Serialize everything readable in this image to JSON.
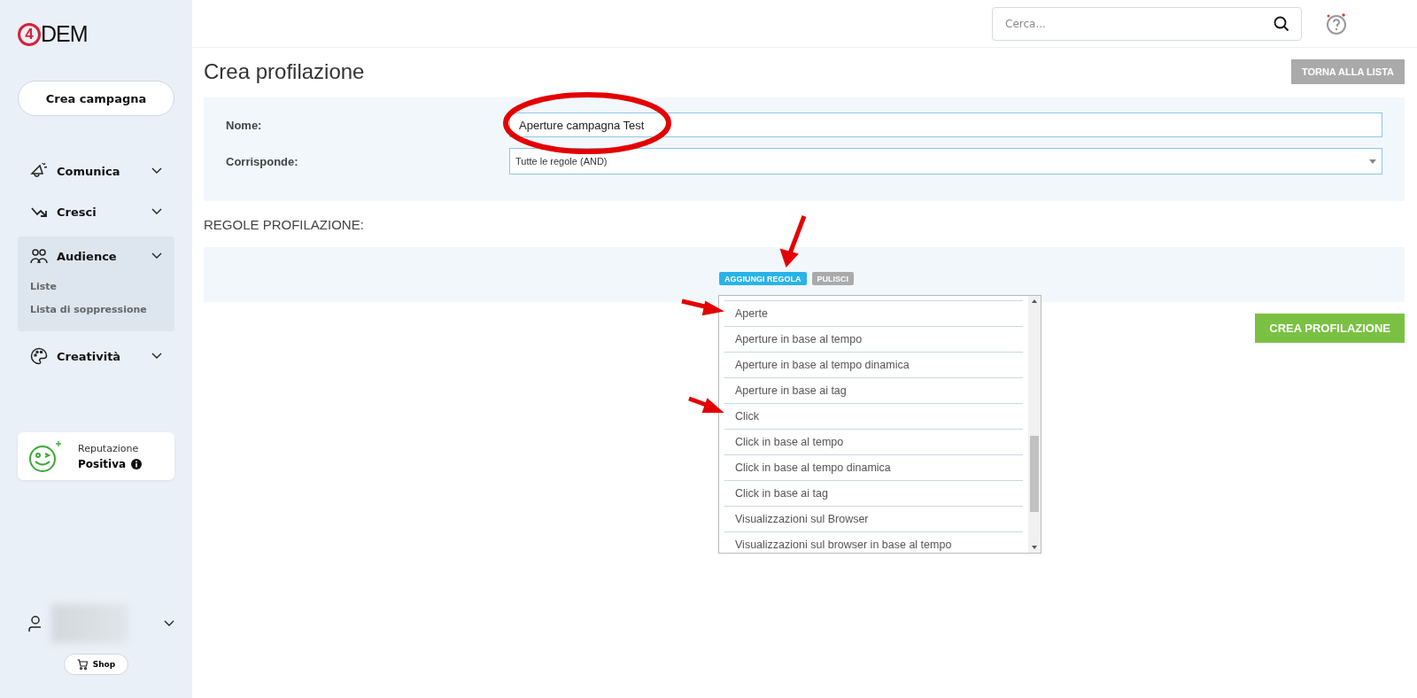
{
  "sidebar": {
    "logo": {
      "mark": "4",
      "text": "DEM"
    },
    "create_button": "Crea campagna",
    "nav": [
      {
        "label": "Comunica",
        "expanded": false
      },
      {
        "label": "Cresci",
        "expanded": false
      },
      {
        "label": "Audience",
        "expanded": true,
        "children": [
          {
            "label": "Liste"
          },
          {
            "label": "Lista di soppressione"
          }
        ]
      },
      {
        "label": "Creatività",
        "expanded": false
      }
    ],
    "reputation": {
      "label": "Reputazione",
      "value": "Positiva"
    },
    "shop_button": "Shop"
  },
  "topbar": {
    "search": {
      "placeholder": "Cerca..."
    }
  },
  "page": {
    "title": "Crea profilazione",
    "back_button": "TORNA ALLA LISTA",
    "form": [
      {
        "label": "Nome:",
        "kind": "input",
        "value": "Aperture campagna Test"
      },
      {
        "label": "Corrisponde:",
        "kind": "select",
        "value": "Tutte le regole (AND)"
      }
    ],
    "rules_heading": "REGOLE PROFILAZIONE:",
    "rule_buttons": [
      {
        "label": "AGGIUNGI REGOLA",
        "kind": "primary"
      },
      {
        "label": "PULISCI",
        "kind": "secondary"
      }
    ],
    "rule_options": [
      {
        "label": "Aperte"
      },
      {
        "label": "Aperture in base al tempo"
      },
      {
        "label": "Aperture in base al tempo dinamica"
      },
      {
        "label": "Aperture in base ai tag"
      },
      {
        "label": "Click"
      },
      {
        "label": "Click in base al tempo"
      },
      {
        "label": "Click in base al tempo dinamica"
      },
      {
        "label": "Click in base ai tag"
      },
      {
        "label": "Visualizzazioni sul Browser"
      },
      {
        "label": "Visualizzazioni sul browser in base al tempo"
      }
    ],
    "submit_button": "CREA PROFILAZIONE"
  }
}
